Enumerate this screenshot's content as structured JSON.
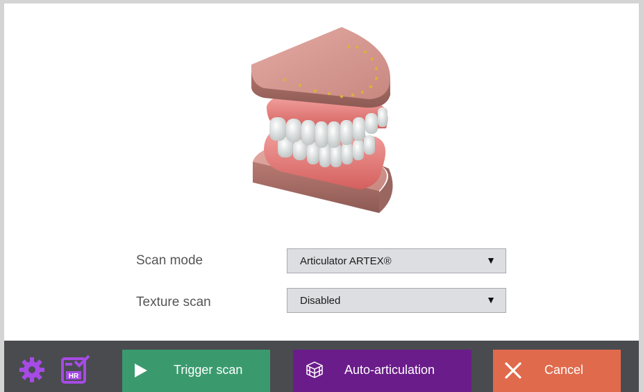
{
  "form": {
    "scan_mode": {
      "label": "Scan mode",
      "value": "Articulator ARTEX®"
    },
    "texture_scan": {
      "label": "Texture scan",
      "value": "Disabled"
    }
  },
  "toolbar": {
    "settings_icon": "gear-icon",
    "hr_icon_text": "HR",
    "trigger_scan_label": "Trigger scan",
    "auto_articulation_label": "Auto-articulation",
    "cancel_label": "Cancel"
  },
  "colors": {
    "trigger": "#3a9a6e",
    "auto": "#6a1c8a",
    "cancel": "#e06a4c",
    "icon_purple": "#a64be6"
  }
}
